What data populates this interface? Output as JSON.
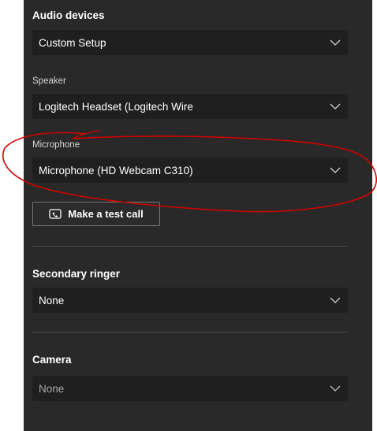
{
  "audio_devices": {
    "heading": "Audio devices",
    "selected": "Custom Setup"
  },
  "speaker": {
    "label": "Speaker",
    "selected": "Logitech Headset (Logitech Wire"
  },
  "microphone": {
    "label": "Microphone",
    "selected": "Microphone (HD Webcam C310)"
  },
  "test_call": {
    "label": "Make a test call",
    "icon": "test-call-icon"
  },
  "secondary_ringer": {
    "heading": "Secondary ringer",
    "selected": "None"
  },
  "camera": {
    "heading": "Camera",
    "selected": "None",
    "disabled": true
  },
  "colors": {
    "panel_background": "#292929",
    "dropdown_background": "#1f1f1f",
    "annotation_stroke": "#d40000"
  }
}
